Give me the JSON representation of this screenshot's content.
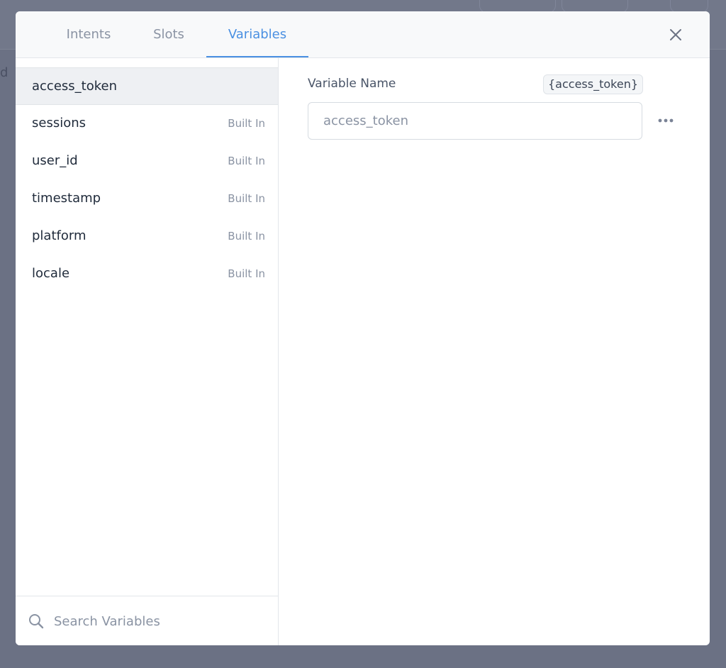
{
  "backdrop": {
    "partial_letter": "d"
  },
  "tabs": [
    {
      "label": "Intents",
      "active": false
    },
    {
      "label": "Slots",
      "active": false
    },
    {
      "label": "Variables",
      "active": true
    }
  ],
  "colors": {
    "accent": "#4a90e2",
    "overlay": "#6b7184",
    "selected_row": "#eef0f3"
  },
  "variables": [
    {
      "name": "access_token",
      "tag": ""
    },
    {
      "name": "sessions",
      "tag": "Built In"
    },
    {
      "name": "user_id",
      "tag": "Built In"
    },
    {
      "name": "timestamp",
      "tag": "Built In"
    },
    {
      "name": "platform",
      "tag": "Built In"
    },
    {
      "name": "locale",
      "tag": "Built In"
    }
  ],
  "search": {
    "placeholder": "Search Variables"
  },
  "detail": {
    "label": "Variable Name",
    "badge": "{access_token}",
    "input_value": "access_token"
  },
  "icons": {
    "close": "close-icon",
    "search": "search-icon",
    "more": "more-horizontal-icon"
  }
}
